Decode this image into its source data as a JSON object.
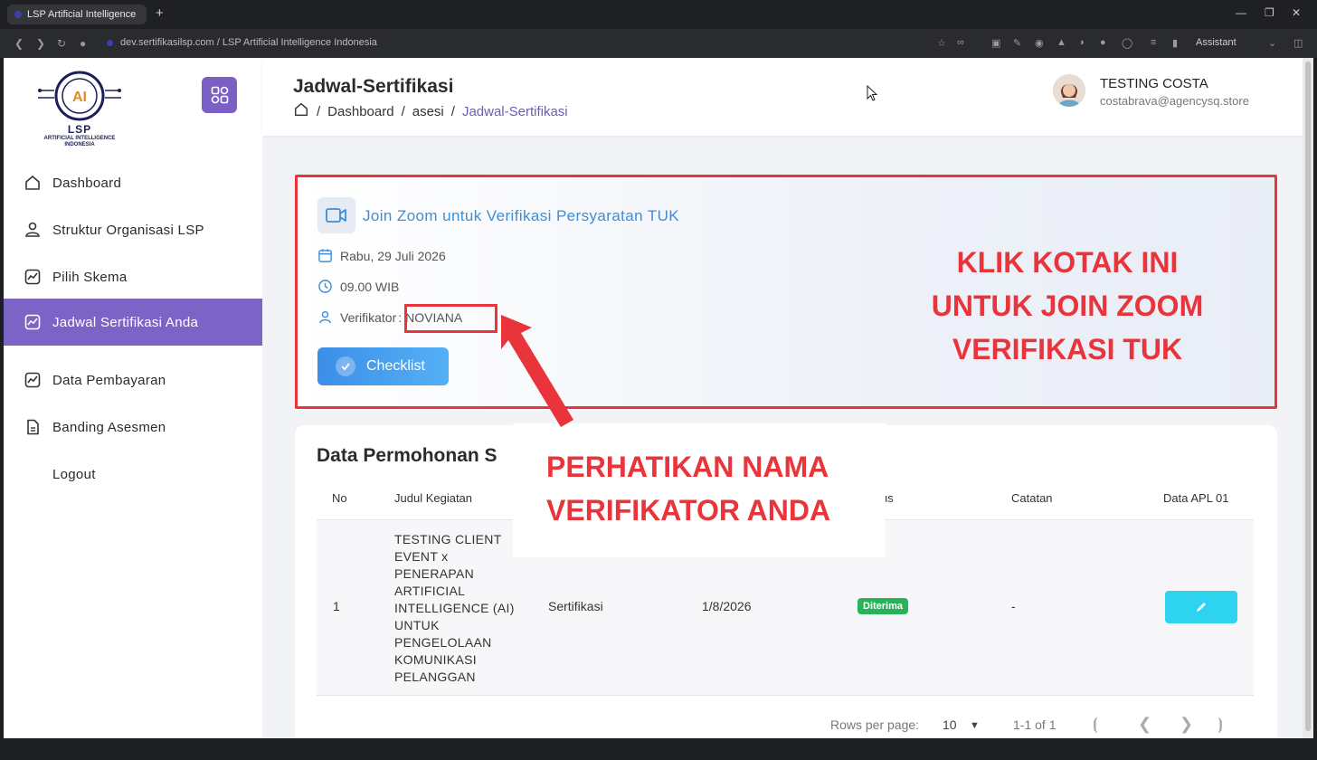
{
  "browser": {
    "tab_title": "LSP Artificial Intelligence",
    "tab_plus": "+",
    "url": "dev.sertifikasilsp.com / LSP Artificial Intelligence Indonesia",
    "assistant_label": "Assistant"
  },
  "sidebar": {
    "logo": {
      "big": "LSP",
      "line1": "ARTIFICIAL INTELLIGENCE",
      "line2": "INDONESIA"
    },
    "items": [
      {
        "label": "Dashboard",
        "icon": "home-icon"
      },
      {
        "label": "Struktur Organisasi LSP",
        "icon": "user-icon"
      },
      {
        "label": "Pilih Skema",
        "icon": "chart-icon"
      },
      {
        "label": "Jadwal Sertifikasi Anda",
        "icon": "chart-icon",
        "active": true
      },
      {
        "label": "Data Pembayaran",
        "icon": "chart-icon"
      },
      {
        "label": "Banding Asesmen",
        "icon": "document-icon"
      },
      {
        "label": "Logout",
        "icon": ""
      }
    ]
  },
  "header": {
    "title": "Jadwal-Sertifikasi",
    "breadcrumb": [
      "Dashboard",
      "asesi",
      "Jadwal-Sertifikasi"
    ],
    "separator": "/",
    "user_name": "TESTING COSTA",
    "user_email": "costabrava@agencysq.store"
  },
  "zoom_card": {
    "title": "Join Zoom untuk Verifikasi Persyaratan TUK",
    "date": "Rabu, 29 Juli 2026",
    "time": "09.00 WIB",
    "verifier_label": "Verifikator",
    "verifier_sep": ":",
    "verifier_name": "NOVIANA",
    "checklist_label": "Checklist",
    "annotation": [
      "KLIK KOTAK INI",
      "UNTUK JOIN ZOOM",
      "VERIFIKASI TUK"
    ]
  },
  "table": {
    "title": "Data Permohonan S",
    "columns": [
      "No",
      "Judul Kegiatan",
      "us",
      "Catatan",
      "Data APL 01"
    ],
    "rows": [
      {
        "no": "1",
        "judul": "TESTING CLIENT EVENT x PENERAPAN ARTIFICIAL INTELLIGENCE (AI) UNTUK PENGELOLAAN KOMUNIKASI PELANGGAN",
        "jenis": "Sertifikasi",
        "tanggal": "1/8/2026",
        "status": "Diterima",
        "catatan": "-"
      }
    ],
    "rows_per_page_label": "Rows per page:",
    "rows_per_page": "10",
    "range": "1-1 of 1"
  },
  "annotation2": [
    "PERHATIKAN NAMA",
    "VERIFIKATOR ANDA"
  ],
  "colors": {
    "primary": "#7b64c6",
    "accent_red": "#e8343a",
    "link_blue": "#3d8ed6",
    "success": "#2ab25a",
    "edit": "#2ed3ef"
  }
}
